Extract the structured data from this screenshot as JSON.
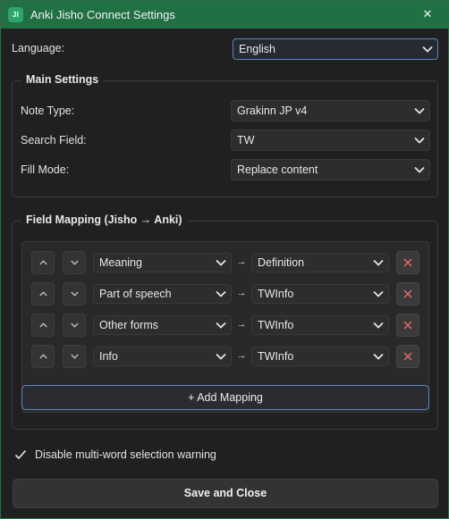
{
  "window": {
    "icon_text": "JI",
    "title": "Anki Jisho Connect Settings",
    "close_glyph": "✕"
  },
  "language": {
    "label": "Language:",
    "value": "English"
  },
  "main_settings": {
    "title": "Main Settings",
    "note_type": {
      "label": "Note Type:",
      "value": "Grakinn JP v4"
    },
    "search_field": {
      "label": "Search Field:",
      "value": "TW"
    },
    "fill_mode": {
      "label": "Fill Mode:",
      "value": "Replace content"
    }
  },
  "field_mapping": {
    "title": "Field Mapping (Jisho → Anki)",
    "arrow": "→",
    "rows": [
      {
        "source": "Meaning",
        "target": "Definition"
      },
      {
        "source": "Part of speech",
        "target": "TWInfo"
      },
      {
        "source": "Other forms",
        "target": "TWInfo"
      },
      {
        "source": "Info",
        "target": "TWInfo"
      }
    ],
    "add_label": "+ Add Mapping"
  },
  "options": {
    "disable_multiword_label": "Disable multi-word selection warning",
    "disable_multiword_checked": true
  },
  "footer": {
    "save_label": "Save and Close"
  },
  "colors": {
    "titlebar": "#207044",
    "accent_border": "#5e86c4",
    "remove_x": "#e06c6c"
  },
  "icons": [
    "app-icon",
    "close-icon",
    "chevron-down-icon",
    "move-up-icon",
    "move-down-icon",
    "remove-icon",
    "checkmark-icon"
  ]
}
